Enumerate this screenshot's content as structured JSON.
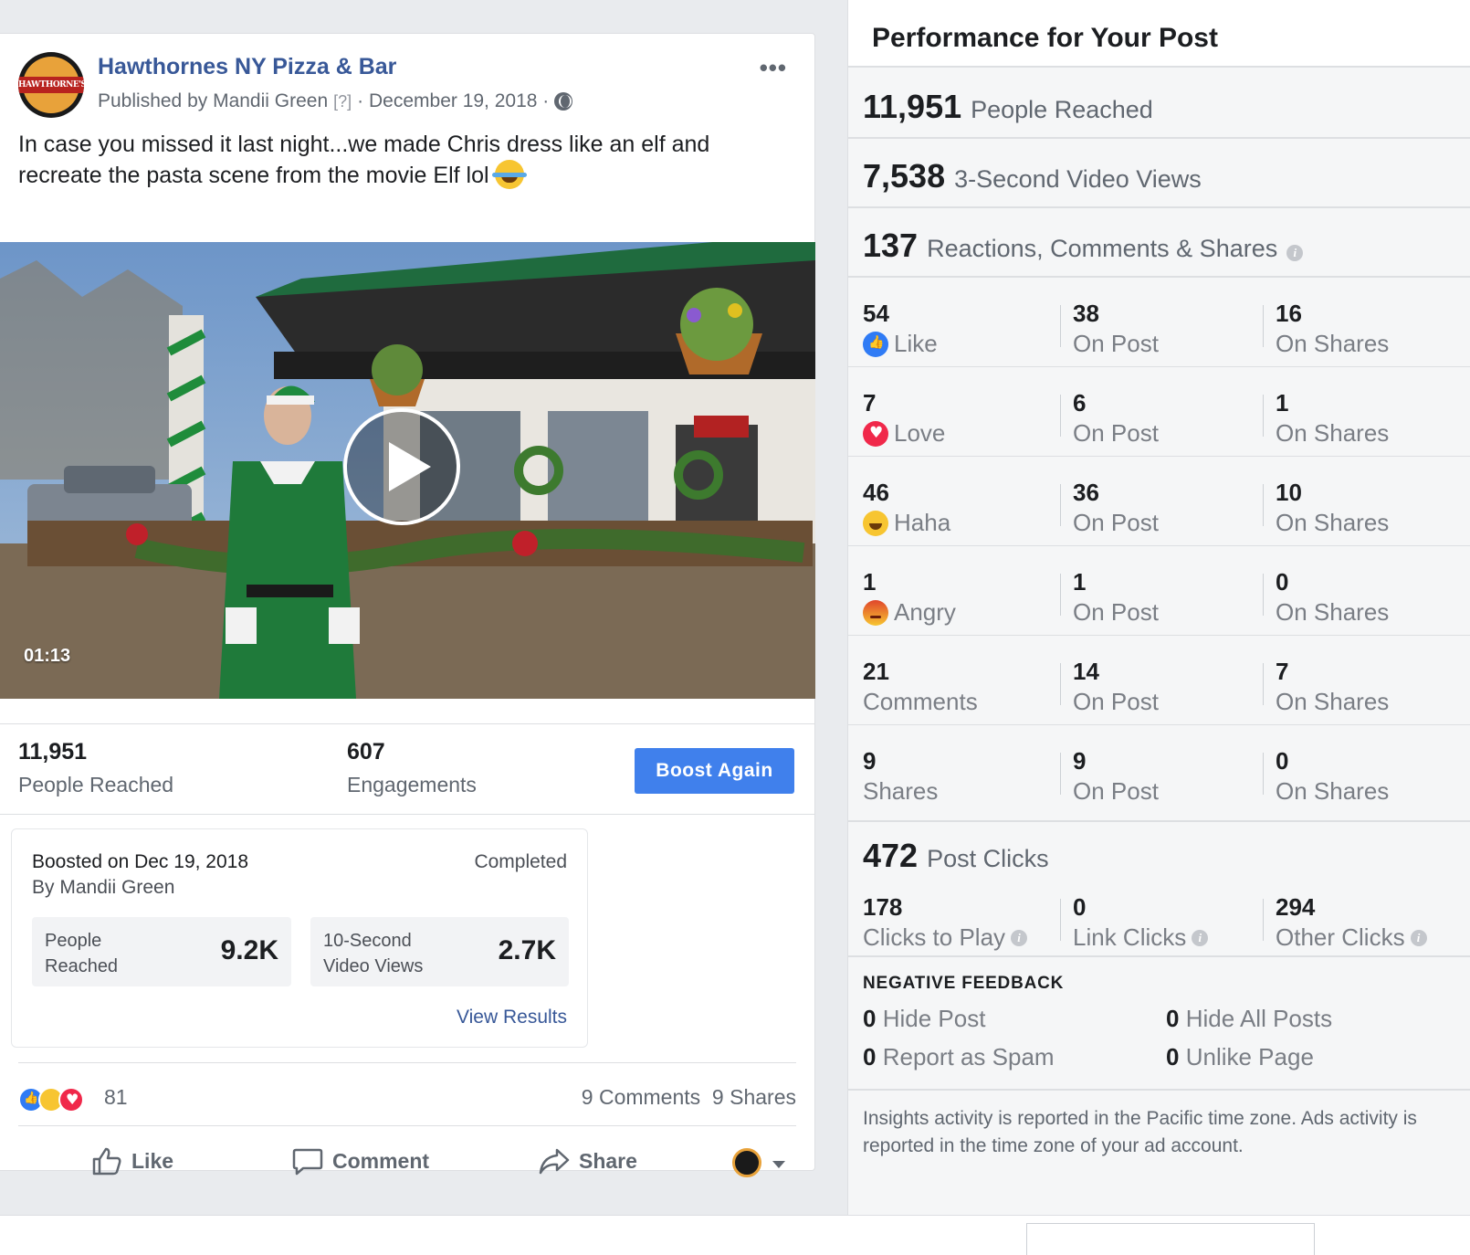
{
  "post": {
    "page_name": "Hawthornes NY Pizza & Bar",
    "published_by": "Published by Mandii Green",
    "help_mark": "[?]",
    "date": "· December 19, 2018 ·",
    "text": "In case you missed it last night...we made Chris dress like an elf and recreate the pasta scene from the movie Elf lol",
    "video_duration": "01:13"
  },
  "summary": {
    "reached_value": "11,951",
    "reached_label": "People Reached",
    "engagements_value": "607",
    "engagements_label": "Engagements",
    "boost_again_label": "Boost Again"
  },
  "boost": {
    "title": "Boosted on Dec 19, 2018",
    "by": "By Mandii Green",
    "status": "Completed",
    "metric1_label_l1": "People",
    "metric1_label_l2": "Reached",
    "metric1_value": "9.2K",
    "metric2_label_l1": "10-Second",
    "metric2_label_l2": "Video Views",
    "metric2_value": "2.7K",
    "view_results": "View Results"
  },
  "social": {
    "reaction_count": "81",
    "comments_shares": "9 Comments  9 Shares",
    "like_label": "Like",
    "comment_label": "Comment",
    "share_label": "Share"
  },
  "insights": {
    "title": "Performance for Your Post",
    "reached_value": "11,951",
    "reached_label": "People Reached",
    "views_value": "7,538",
    "views_label": "3-Second Video Views",
    "rcs_value": "137",
    "rcs_label": "Reactions, Comments & Shares",
    "on_post_label": "On Post",
    "on_shares_label": "On Shares",
    "rows": [
      {
        "total": "54",
        "label": "Like",
        "icon": "like-icon",
        "on_post": "38",
        "on_shares": "16"
      },
      {
        "total": "7",
        "label": "Love",
        "icon": "love-icon",
        "on_post": "6",
        "on_shares": "1"
      },
      {
        "total": "46",
        "label": "Haha",
        "icon": "haha-icon",
        "on_post": "36",
        "on_shares": "10"
      },
      {
        "total": "1",
        "label": "Angry",
        "icon": "angry-icon",
        "on_post": "1",
        "on_shares": "0"
      },
      {
        "total": "21",
        "label": "Comments",
        "icon": "",
        "on_post": "14",
        "on_shares": "7"
      },
      {
        "total": "9",
        "label": "Shares",
        "icon": "",
        "on_post": "9",
        "on_shares": "0"
      }
    ],
    "clicks_value": "472",
    "clicks_label": "Post Clicks",
    "clicks": [
      {
        "value": "178",
        "label": "Clicks to Play"
      },
      {
        "value": "0",
        "label": "Link Clicks"
      },
      {
        "value": "294",
        "label": "Other Clicks"
      }
    ],
    "negative_title": "NEGATIVE FEEDBACK",
    "negative": [
      {
        "value": "0",
        "label": "Hide Post"
      },
      {
        "value": "0",
        "label": "Hide All Posts"
      },
      {
        "value": "0",
        "label": "Report as Spam"
      },
      {
        "value": "0",
        "label": "Unlike Page"
      }
    ],
    "footnote": "Insights activity is reported in the Pacific time zone. Ads activity is reported in the time zone of your ad account."
  },
  "colors": {
    "link_blue": "#385898",
    "boost_button": "#4080ec",
    "like_blue": "#2f7bf5",
    "love_red": "#f0284a",
    "haha_yellow": "#f7c531"
  }
}
